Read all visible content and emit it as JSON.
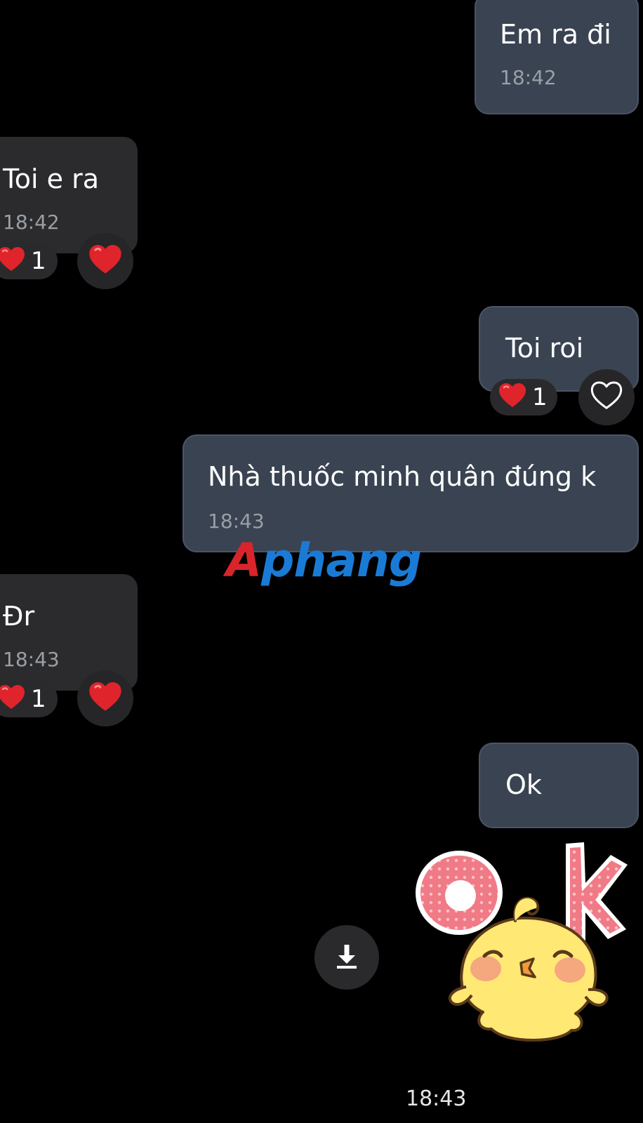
{
  "messages": [
    {
      "id": "m1",
      "direction": "sent",
      "text": "Em ra đi",
      "time": "18:42"
    },
    {
      "id": "m2",
      "direction": "received",
      "text": "Toi e ra",
      "time": "18:42",
      "reaction_count": "1"
    },
    {
      "id": "m3",
      "direction": "sent",
      "text": "Toi roi",
      "reaction_count": "1"
    },
    {
      "id": "m4",
      "direction": "sent",
      "text": "Nhà thuốc minh quân đúng k",
      "time": "18:43"
    },
    {
      "id": "m5",
      "direction": "received",
      "text": "Đr",
      "time": "18:43",
      "reaction_count": "1"
    },
    {
      "id": "m6",
      "direction": "sent",
      "text": "Ok"
    }
  ],
  "sticker": {
    "text": "OK",
    "time": "18:43"
  },
  "watermark": {
    "first": "A",
    "rest": "phang"
  },
  "icons": {
    "reaction": "red-heart-icon",
    "react_button_filled": "red-heart-icon",
    "react_button_outline": "heart-outline-icon",
    "download": "download-icon"
  },
  "colors": {
    "background": "#000000",
    "sent_bubble": "#3a4352",
    "received_bubble": "#2b2b2d",
    "heart": "#e0242b",
    "timestamp": "#9a9fa6"
  }
}
